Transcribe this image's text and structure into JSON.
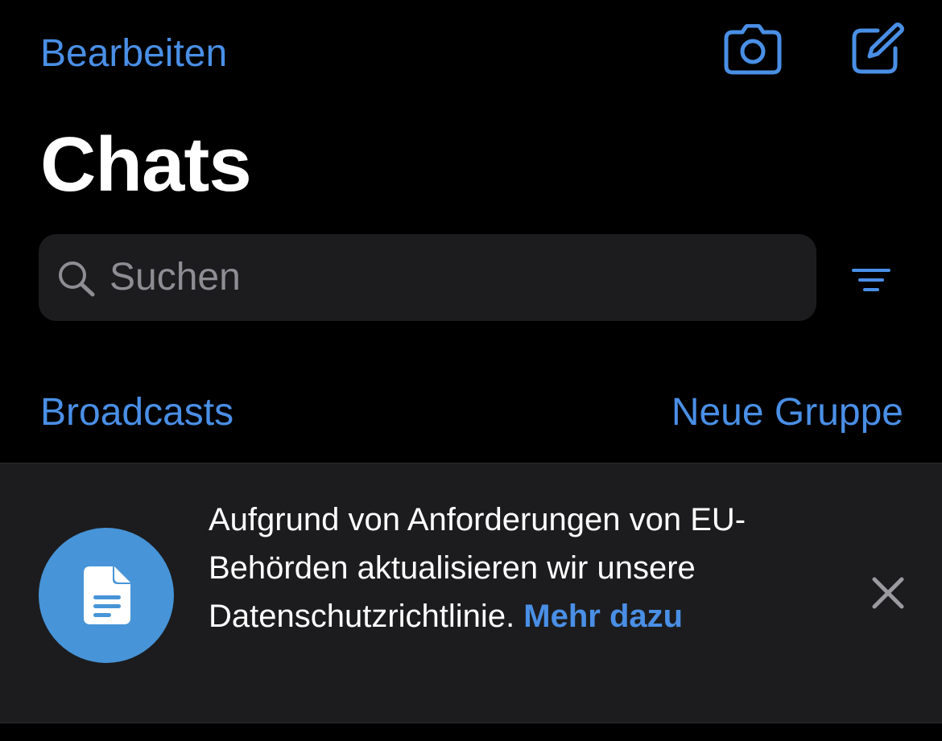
{
  "header": {
    "edit_label": "Bearbeiten",
    "camera_icon": "camera-icon",
    "compose_icon": "compose-icon"
  },
  "page_title": "Chats",
  "search": {
    "placeholder": "Suchen",
    "icon": "search-icon"
  },
  "filter_icon": "filter-icon",
  "links": {
    "broadcasts": "Broadcasts",
    "new_group": "Neue Gruppe"
  },
  "banner": {
    "icon": "document-icon",
    "message": "Aufgrund von Anforderungen von EU-Behörden aktualisieren wir unsere Datenschutzrichtlinie. ",
    "more_link": "Mehr dazu",
    "close_icon": "close-icon"
  },
  "colors": {
    "background": "#000000",
    "accent": "#4a8fe6",
    "surface": "#1c1c1e",
    "avatar": "#4794d8",
    "secondary_text": "#8d8d93"
  }
}
